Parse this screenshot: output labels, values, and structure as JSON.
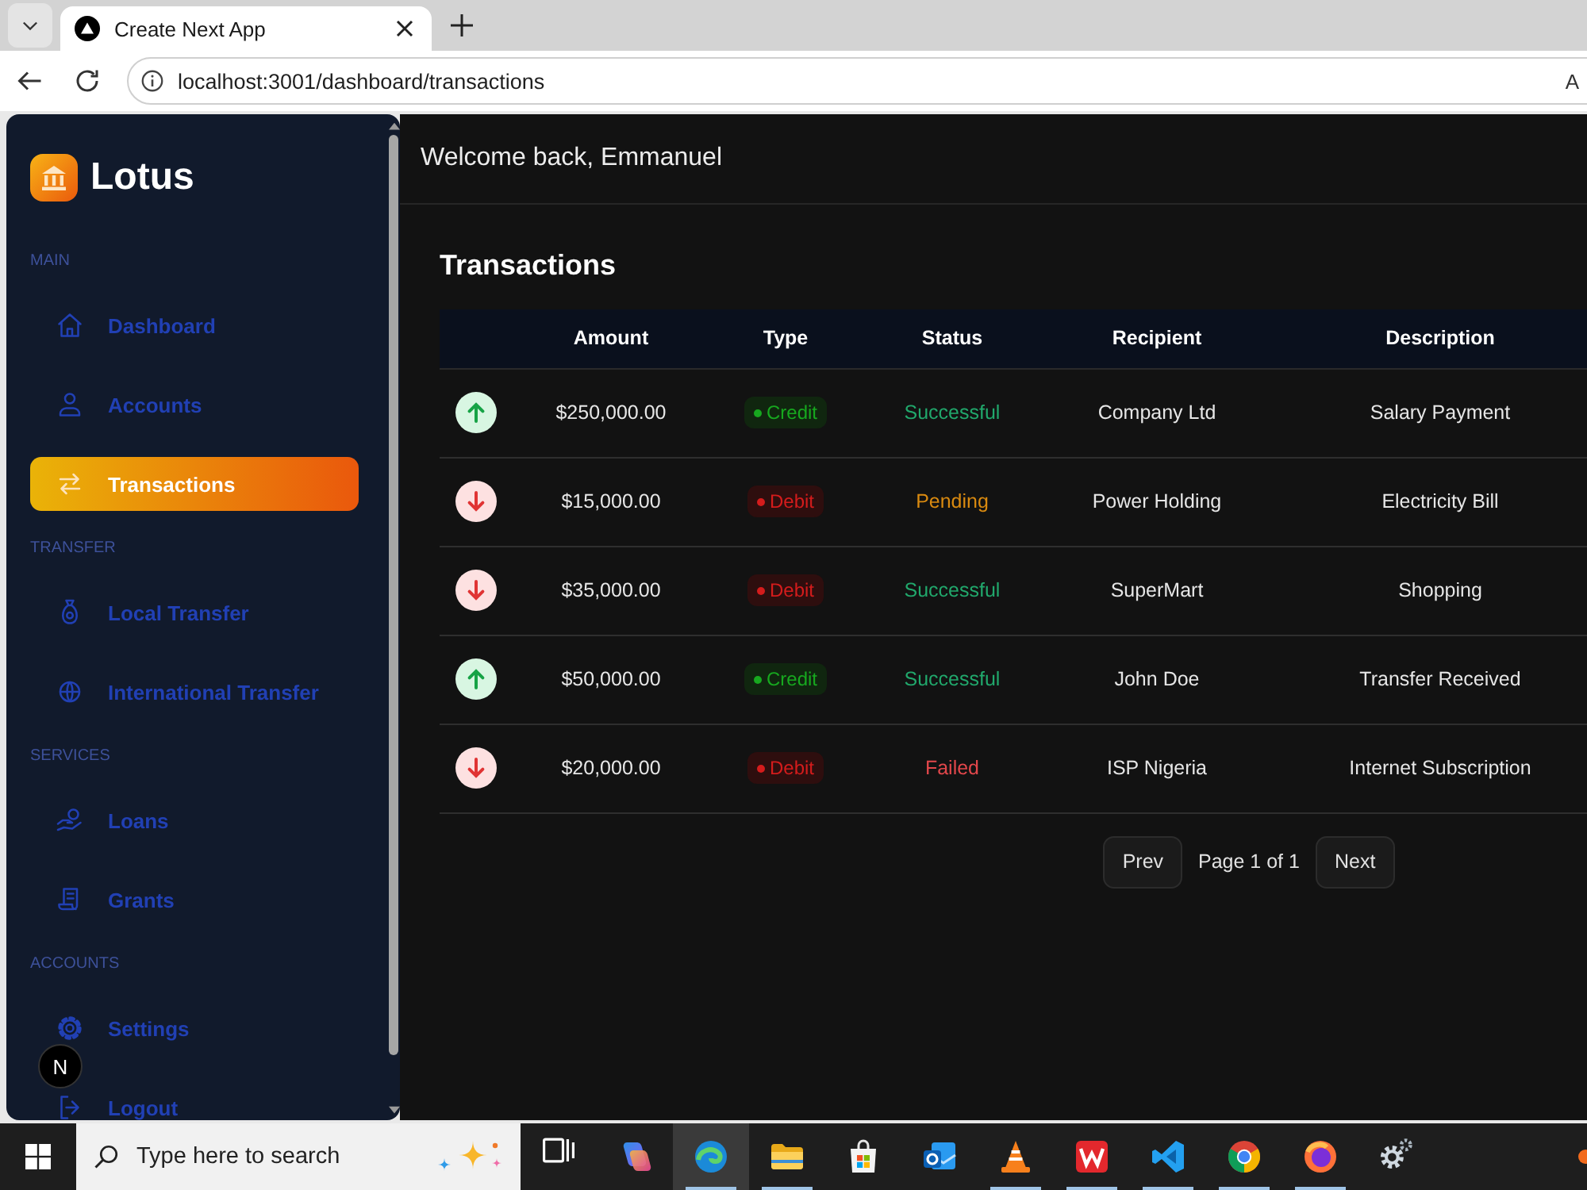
{
  "browser": {
    "tab": {
      "title": "Create Next App"
    },
    "address_bar": {
      "url": "localhost:3001/dashboard/transactions",
      "cut_off_text": "A"
    }
  },
  "sidebar": {
    "brand": "Lotus",
    "sections": [
      {
        "label": "MAIN",
        "items": [
          {
            "label": "Dashboard",
            "selected": false
          },
          {
            "label": "Accounts",
            "selected": false
          },
          {
            "label": "Transactions",
            "selected": true
          }
        ]
      },
      {
        "label": "TRANSFER",
        "items": [
          {
            "label": "Local Transfer",
            "selected": false
          },
          {
            "label": "International Transfer",
            "selected": false
          }
        ]
      },
      {
        "label": "SERVICES",
        "items": [
          {
            "label": "Loans",
            "selected": false
          },
          {
            "label": "Grants",
            "selected": false
          }
        ]
      },
      {
        "label": "ACCOUNTS",
        "items": [
          {
            "label": "Settings",
            "selected": false
          },
          {
            "label": "Logout",
            "selected": false
          }
        ]
      }
    ]
  },
  "dev_badge": {
    "label": "N"
  },
  "header": {
    "greeting": "Welcome back, Emmanuel"
  },
  "transactions": {
    "title": "Transactions",
    "table": {
      "columns": [
        "Amount",
        "Type",
        "Status",
        "Recipient",
        "Description"
      ],
      "rows": [
        {
          "kind": "credit",
          "amount": "$250,000.00",
          "type": "Credit",
          "status": {
            "text": "Successful",
            "color": "#21a86c"
          },
          "recipient": "Company Ltd",
          "description": "Salary Payment"
        },
        {
          "kind": "debit",
          "amount": "$15,000.00",
          "type": "Debit",
          "status": {
            "text": "Pending",
            "color": "#d98a10"
          },
          "recipient": "Power Holding",
          "description": "Electricity Bill"
        },
        {
          "kind": "debit",
          "amount": "$35,000.00",
          "type": "Debit",
          "status": {
            "text": "Successful",
            "color": "#21a86c"
          },
          "recipient": "SuperMart",
          "description": "Shopping"
        },
        {
          "kind": "credit",
          "amount": "$50,000.00",
          "type": "Credit",
          "status": {
            "text": "Successful",
            "color": "#21a86c"
          },
          "recipient": "John Doe",
          "description": "Transfer Received"
        },
        {
          "kind": "debit",
          "amount": "$20,000.00",
          "type": "Debit",
          "status": {
            "text": "Failed",
            "color": "#e2474b"
          },
          "recipient": "ISP Nigeria",
          "description": "Internet Subscription"
        }
      ]
    },
    "pagination": {
      "prev": "Prev",
      "page_info": "Page 1 of 1",
      "next": "Next"
    }
  },
  "taskbar": {
    "search": {
      "placeholder": "Type here to search"
    },
    "apps": [
      {
        "kind": "task-view",
        "running": false,
        "selected": false
      },
      {
        "kind": "swirl",
        "running": false,
        "selected": false
      },
      {
        "kind": "wave-circle",
        "running": true,
        "selected": true
      },
      {
        "kind": "folder",
        "running": true,
        "selected": false
      },
      {
        "kind": "bag",
        "running": false,
        "selected": false
      },
      {
        "kind": "mail",
        "running": false,
        "selected": false
      },
      {
        "kind": "cone",
        "running": true,
        "selected": false
      },
      {
        "kind": "zigzag-tile",
        "running": true,
        "selected": false
      },
      {
        "kind": "ribbon-tile",
        "running": true,
        "selected": false
      },
      {
        "kind": "segmented-circle",
        "running": true,
        "selected": false
      },
      {
        "kind": "globe-swirl",
        "running": true,
        "selected": false
      },
      {
        "kind": "gears",
        "running": false,
        "selected": false
      }
    ]
  }
}
